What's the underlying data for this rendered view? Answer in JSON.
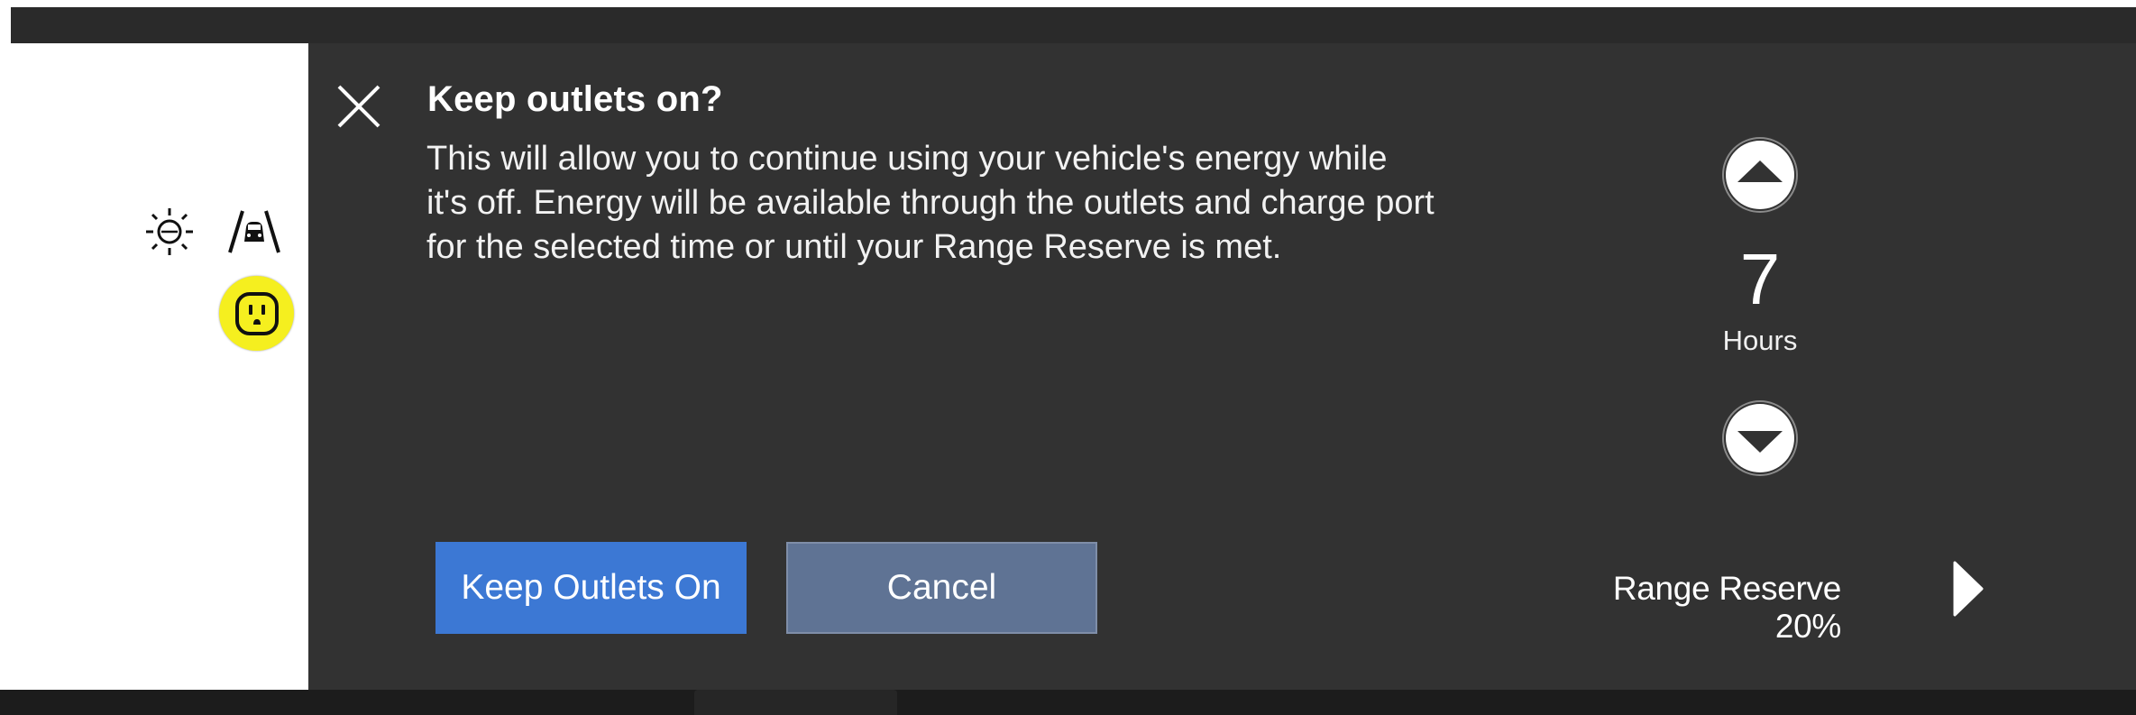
{
  "dialog": {
    "title": "Keep outlets on?",
    "message": "This will allow you to continue using your vehicle's energy while it's off. Energy will be available through the outlets and charge port for the selected time or until your Range Reserve is met.",
    "close_icon": "close-icon"
  },
  "timer": {
    "value": "7",
    "unit": "Hours",
    "up_icon": "triangle-up-icon",
    "down_icon": "triangle-down-icon"
  },
  "buttons": {
    "primary_label": "Keep Outlets On",
    "secondary_label": "Cancel"
  },
  "range_reserve": {
    "label": "Range Reserve 20%",
    "arrow_icon": "chevron-right-icon"
  },
  "status_icons": {
    "items": [
      "light-icon",
      "lane-assist-icon",
      "power-outlet-icon"
    ],
    "outlet_active_color": "#f5ef1f"
  },
  "colors": {
    "dialog_bg": "#323232",
    "primary_button": "#3c78d4",
    "secondary_button": "#5f7394"
  }
}
